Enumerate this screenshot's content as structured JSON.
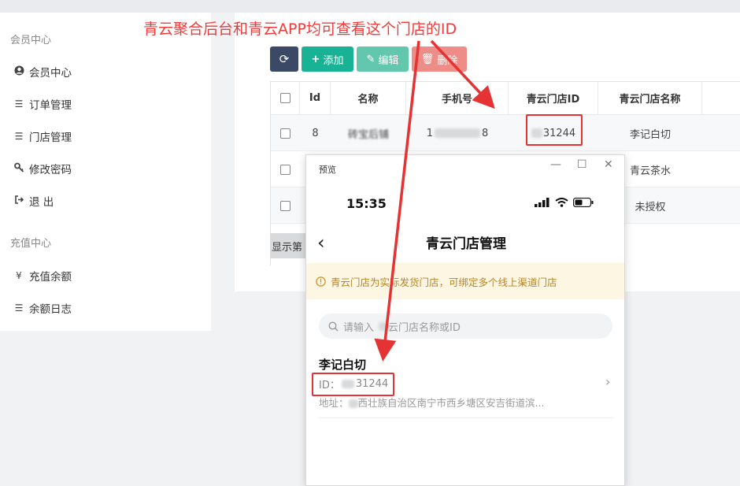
{
  "annotation": {
    "text": "青云聚合后台和青云APP均可查看这个门店的ID",
    "color": "#f03b3b"
  },
  "sidebar": {
    "groups": [
      {
        "title": "会员中心",
        "items": [
          {
            "icon": "user-circle-icon",
            "glyph": "👤",
            "label": "会员中心"
          },
          {
            "icon": "list-icon",
            "glyph": "☰",
            "label": "订单管理"
          },
          {
            "icon": "list-icon",
            "glyph": "☰",
            "label": "门店管理"
          },
          {
            "icon": "key-icon",
            "glyph": "🔑",
            "label": "修改密码"
          },
          {
            "icon": "sign-out-icon",
            "glyph": "⏏",
            "label": "退 出"
          }
        ]
      },
      {
        "title": "充值中心",
        "items": [
          {
            "icon": "yen-icon",
            "glyph": "¥",
            "label": "充值余额"
          },
          {
            "icon": "list-alt-icon",
            "glyph": "☰",
            "label": "余额日志"
          }
        ]
      }
    ]
  },
  "toolbar": {
    "refresh_glyph": "⟳",
    "add_label": "添加",
    "edit_label": "编辑",
    "delete_label": "删除"
  },
  "table": {
    "headers": [
      "Id",
      "名称",
      "手机号",
      "青云门店ID",
      "青云门店名称"
    ],
    "rows": [
      {
        "id": "8",
        "name": "砖宝后铺",
        "phone_prefix": "1",
        "phone_suffix": "8",
        "store_id": "31244",
        "store_name": "李记白切"
      },
      {
        "id": "",
        "name": "",
        "phone_prefix": "",
        "phone_suffix": "",
        "store_id": "",
        "store_name": "青云茶水"
      },
      {
        "id": "",
        "name": "",
        "phone_prefix": "",
        "phone_suffix": "",
        "store_id": "",
        "store_name": "未授权"
      }
    ],
    "footer_text": "显示第"
  },
  "preview": {
    "window_title": "预览",
    "status_time": "15:35",
    "nav_title": "青云门店管理",
    "notice": "青云门店为实际发货门店，可绑定多个线上渠道门店",
    "search_placeholder_prefix": "请输入",
    "search_placeholder_suffix": "云门店名称或ID",
    "store": {
      "name": "李记白切",
      "id_label": "ID：",
      "id_suffix": "31244",
      "address_label": "地址：",
      "address_value": "西壮族自治区南宁市西乡塘区安吉街道滨..."
    }
  },
  "colors": {
    "accent_red": "#e53333",
    "add_green": "#18b394",
    "edit_green": "#62c7ac",
    "delete_red": "#ee8d87",
    "refresh_navy": "#3a4a66",
    "notice_bg": "#fdf6e3"
  }
}
